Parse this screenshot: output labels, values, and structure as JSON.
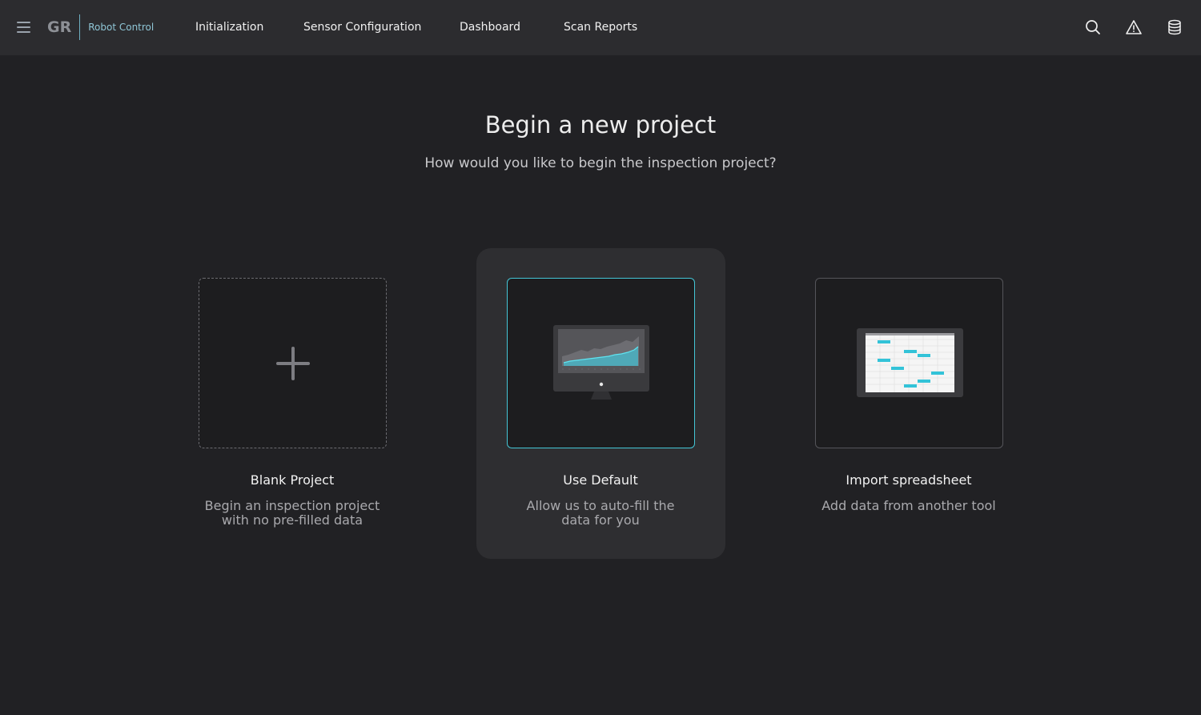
{
  "header": {
    "logo": "GR",
    "app_name": "Robot Control",
    "nav": [
      {
        "label": "Initialization"
      },
      {
        "label": "Sensor Configuration"
      },
      {
        "label": "Dashboard"
      },
      {
        "label": "Scan Reports"
      }
    ],
    "actions": [
      "search-icon",
      "alert-triangle-icon",
      "database-icon"
    ]
  },
  "main": {
    "title": "Begin a new project",
    "subtitle": "How would you like to begin the inspection project?",
    "options": [
      {
        "title": "Blank Project",
        "desc_line1": "Begin an inspection project",
        "desc_line2": "with no pre-filled data",
        "icon": "plus-icon"
      },
      {
        "title": "Use Default",
        "desc_line1": "Allow us to auto-fill the",
        "desc_line2": "data for you",
        "icon": "monitor-chart-icon",
        "selected": true
      },
      {
        "title": "Import spreadsheet",
        "desc_line1": "Add data from another  tool",
        "icon": "spreadsheet-icon"
      }
    ]
  },
  "colors": {
    "background": "#212124",
    "topbar": "#2c2c2f",
    "accent": "#44c6d6",
    "selected_panel": "#2e2e31"
  }
}
